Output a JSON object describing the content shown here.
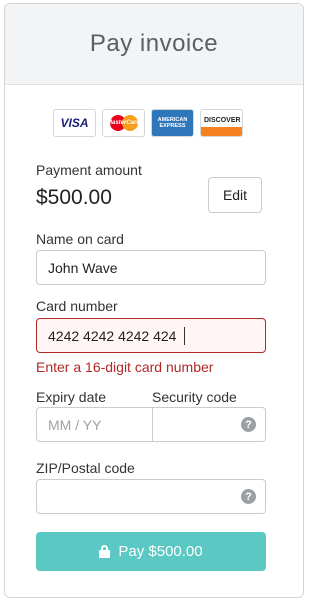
{
  "header": {
    "title": "Pay invoice"
  },
  "card_logos": [
    {
      "name": "visa-logo",
      "text": "VISA"
    },
    {
      "name": "mastercard-logo",
      "text": "MasterCard"
    },
    {
      "name": "amex-logo",
      "text": "AMERICAN EXPRESS"
    },
    {
      "name": "discover-logo",
      "text": "DISCOVER"
    }
  ],
  "payment": {
    "label": "Payment amount",
    "amount": "$500.00",
    "edit_label": "Edit"
  },
  "name_on_card": {
    "label": "Name on card",
    "value": "John Wave"
  },
  "card_number": {
    "label": "Card number",
    "value": "4242 4242 4242 424",
    "error": "Enter a 16-digit card number"
  },
  "expiry": {
    "label": "Expiry date",
    "placeholder": "MM / YY"
  },
  "security_code": {
    "label": "Security code",
    "help": "?"
  },
  "zip": {
    "label": "ZIP/Postal code",
    "help": "?"
  },
  "pay_button": {
    "label": "Pay $500.00"
  },
  "colors": {
    "accent": "#5bc8c3",
    "error": "#b22929",
    "header_bg": "#f2f4f6"
  }
}
